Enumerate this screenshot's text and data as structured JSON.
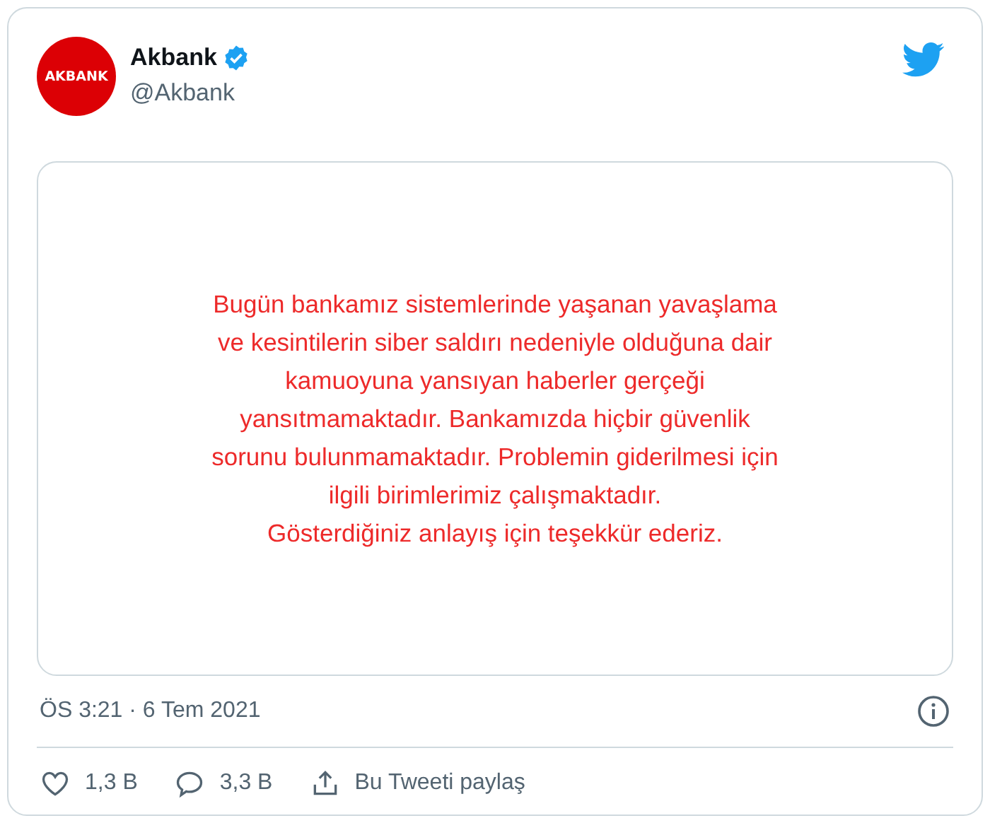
{
  "account": {
    "logo_text": "AKBANK",
    "name": "Akbank",
    "verified": true,
    "handle": "@Akbank"
  },
  "media": {
    "lines": [
      "Bugün bankamız sistemlerinde yaşanan yavaşlama",
      "ve kesintilerin siber saldırı nedeniyle olduğuna dair",
      "kamuoyuna yansıyan haberler gerçeği",
      "yansıtmamaktadır. Bankamızda hiçbir güvenlik",
      "sorunu bulunmamaktadır. Problemin giderilmesi için",
      "ilgili birimlerimiz çalışmaktadır.",
      "Gösterdiğiniz anlayış için teşekkür ederiz."
    ]
  },
  "timestamp": "ÖS 3:21 · 6 Tem 2021",
  "actions": [
    {
      "kind": "like",
      "label": "1,3 B"
    },
    {
      "kind": "reply",
      "label": "3,3 B"
    },
    {
      "kind": "share",
      "label": "Bu Tweeti paylaş"
    }
  ]
}
